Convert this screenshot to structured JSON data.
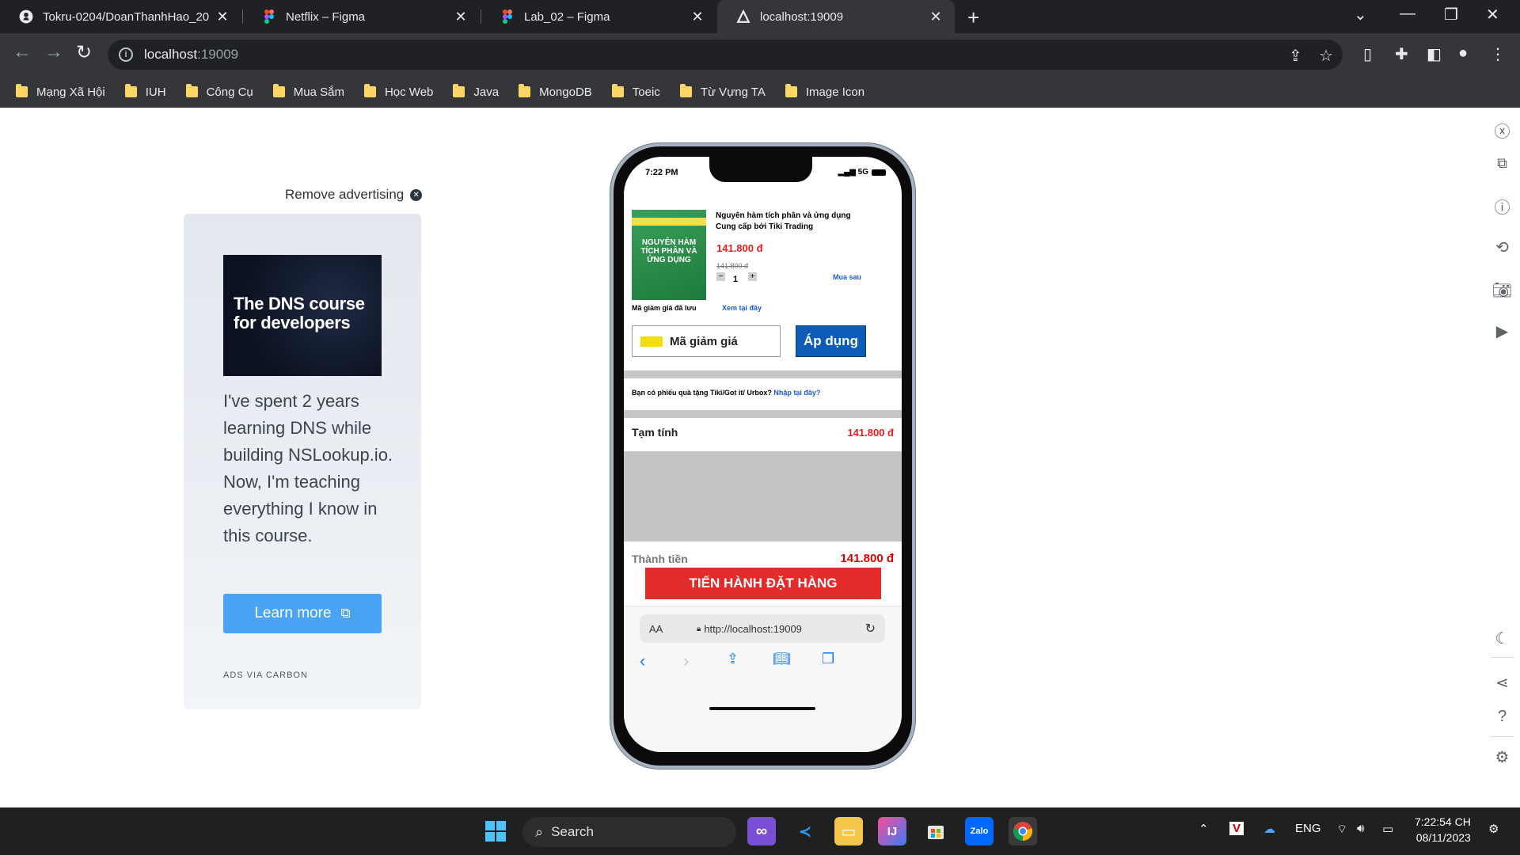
{
  "tabs": [
    {
      "title": "Tokru-0204/DoanThanhHao_20",
      "icon": "github-icon"
    },
    {
      "title": "Netflix – Figma",
      "icon": "figma-icon"
    },
    {
      "title": "Lab_02 – Figma",
      "icon": "figma-icon"
    },
    {
      "title": "localhost:19009",
      "icon": "expo-icon",
      "active": true
    }
  ],
  "address": {
    "host": "localhost",
    "port": ":19009"
  },
  "bookmarks": [
    "Mạng Xã Hội",
    "IUH",
    "Công Cụ",
    "Mua Sắm",
    "Học Web",
    "Java",
    "MongoDB",
    "Toeic",
    "Từ Vựng TA",
    "Image Icon"
  ],
  "ad": {
    "remove": "Remove advertising",
    "image_text": "The DNS course for developers",
    "body": "I've spent 2 years learning DNS while building NSLookup.io. Now, I'm teaching everything I know in this course.",
    "button": "Learn more",
    "via": "ADS VIA CARBON",
    "colors": {
      "button": "#4aa3f5",
      "card": "#e3e8ef"
    }
  },
  "phone": {
    "time": "7:22 PM",
    "network": "5G",
    "product": {
      "cover_title": "NGUYÊN HÀM TÍCH PHÂN VÀ ỨNG DỤNG",
      "name": "Nguyên hàm tích phân và ứng dụng",
      "provider": "Cung cấp bởi Tiki Trading",
      "price": "141.800 đ",
      "old_price": "141.800 đ",
      "qty_minus": "−",
      "qty_plus": "+",
      "quantity": "1",
      "buy_later": "Mua sau"
    },
    "coupon": {
      "saved_label": "Mã giảm giá đã lưu",
      "view_link": "Xem tại đây",
      "input_placeholder": "Mã giảm giá",
      "apply": "Áp dụng"
    },
    "gift": {
      "text": "Bạn có phiếu quà tặng Tiki/Got it/ Urbox?",
      "link": "Nhập tại đây?"
    },
    "subtotal": {
      "label": "Tạm tính",
      "value": "141.800 đ"
    },
    "total": {
      "label": "Thành tiền",
      "value": "141.800 đ"
    },
    "order_button": "TIẾN HÀNH ĐẶT HÀNG",
    "safari": {
      "aa": "AA",
      "url": "http://localhost:19009"
    },
    "colors": {
      "price": "#e02020",
      "apply": "#0d5cb8",
      "order": "#e32b2b"
    }
  },
  "taskbar": {
    "search": "Search",
    "lang": "ENG",
    "time": "7:22:54 CH",
    "date": "08/11/2023"
  }
}
